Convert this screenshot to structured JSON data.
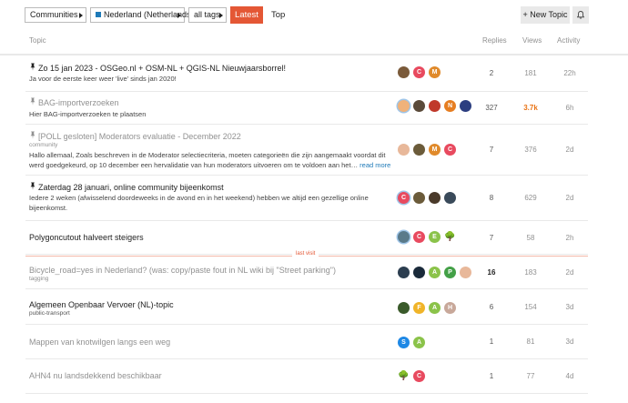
{
  "nav": {
    "categories": "Communities",
    "tag_category": "Nederland (Netherlands)",
    "tags": "all tags",
    "latest": "Latest",
    "top": "Top",
    "new_topic": "+ New Topic",
    "bell_icon": "bell-icon",
    "accent": "#e45735"
  },
  "columns": {
    "topic": "Topic",
    "replies": "Replies",
    "views": "Views",
    "activity": "Activity"
  },
  "last_visit": "last visit",
  "topics": [
    {
      "title": "Zo 15 jan 2023 - OSGeo.nl + OSM-NL + QGIS-NL Nieuwjaarsborrel!",
      "pinned": true,
      "read": false,
      "excerpt": "Ja voor de eerste keer weer 'live' sinds jan 2020!",
      "replies": "2",
      "views": "181",
      "activity": "22h",
      "avatars": [
        {
          "c": "#7a5a3a",
          "t": ""
        },
        {
          "c": "#e84a5f",
          "t": "C"
        },
        {
          "c": "#e08a2b",
          "t": "M"
        }
      ]
    },
    {
      "title": "BAG-importverzoeken",
      "pinned": true,
      "read": true,
      "excerpt": "Hier BAG-importverzoeken te plaatsen",
      "replies": "327",
      "views": "3.7k",
      "activity": "6h",
      "hot": true,
      "avatars": [
        {
          "c": "#f0b27a",
          "t": "",
          "ring": true
        },
        {
          "c": "#5a4a3a",
          "t": ""
        },
        {
          "c": "#c0392b",
          "t": ""
        },
        {
          "c": "#e67e22",
          "t": "N"
        },
        {
          "c": "#2c3e80",
          "t": ""
        }
      ]
    },
    {
      "title": "[POLL gesloten] Moderators evaluatie - December 2022",
      "pinned": true,
      "read": true,
      "category": "community",
      "excerpt_line1": "Hallo allemaal, Zoals beschreven in de Moderator selectiecriteria, moeten categorieën die zijn aangemaakt voordat dit",
      "excerpt_line2": "werd goedgekeurd, op 10 december een hervalidatie van hun moderators uitvoeren om te voldoen aan het…",
      "read_more": "read more",
      "replies": "7",
      "views": "376",
      "activity": "2d",
      "avatars": [
        {
          "c": "#e8b89a",
          "t": ""
        },
        {
          "c": "#6b5b3a",
          "t": ""
        },
        {
          "c": "#e08a2b",
          "t": "M"
        },
        {
          "c": "#e84a5f",
          "t": "C"
        }
      ]
    },
    {
      "title": "Zaterdag 28 januari, online community bijeenkomst",
      "pinned": true,
      "read": false,
      "excerpt_line1": "Iedere 2 weken (afwisselend doordeweeks in de avond en in het weekend) hebben we altijd een gezellige online",
      "excerpt_line2": "bijeenkomst.",
      "replies": "8",
      "views": "629",
      "activity": "2d",
      "avatars": [
        {
          "c": "#e84a5f",
          "t": "C",
          "ring": true
        },
        {
          "c": "#6b5b3a",
          "t": ""
        },
        {
          "c": "#4a3a2a",
          "t": ""
        },
        {
          "c": "#3a4a5a",
          "t": ""
        }
      ]
    },
    {
      "title": "Polygoncutout halveert steigers",
      "pinned": false,
      "read": false,
      "replies": "7",
      "views": "58",
      "activity": "2h",
      "avatars": [
        {
          "c": "#5a7a8a",
          "t": "",
          "ring": true
        },
        {
          "c": "#e84a5f",
          "t": "C"
        },
        {
          "c": "#8bc34a",
          "t": "E"
        },
        {
          "c": "#2e7d32",
          "t": "🌳"
        }
      ]
    },
    {
      "title": "Bicycle_road=yes in Nederland? (was: copy/paste fout in NL wiki bij \"Street parking\")",
      "pinned": false,
      "read": true,
      "category": "tagging",
      "replies": "16",
      "views": "183",
      "activity": "2d",
      "bold_replies": true,
      "avatars": [
        {
          "c": "#2c3e50",
          "t": ""
        },
        {
          "c": "#1a2a3a",
          "t": ""
        },
        {
          "c": "#8bc34a",
          "t": "A"
        },
        {
          "c": "#43a047",
          "t": "P"
        },
        {
          "c": "#e8b89a",
          "t": ""
        }
      ]
    },
    {
      "title": "Algemeen Openbaar Vervoer (NL)-topic",
      "pinned": false,
      "read": false,
      "category": "public-transport",
      "replies": "6",
      "views": "154",
      "activity": "3d",
      "avatars": [
        {
          "c": "#3a5a2a",
          "t": ""
        },
        {
          "c": "#f0b429",
          "t": "F"
        },
        {
          "c": "#8bc34a",
          "t": "A"
        },
        {
          "c": "#c8a89a",
          "t": "H"
        }
      ]
    },
    {
      "title": "Mappen van knotwilgen langs een weg",
      "pinned": false,
      "read": true,
      "replies": "1",
      "views": "81",
      "activity": "3d",
      "avatars": [
        {
          "c": "#1e88e5",
          "t": "S"
        },
        {
          "c": "#8bc34a",
          "t": "A"
        }
      ]
    },
    {
      "title": "AHN4 nu landsdekkend beschikbaar",
      "pinned": false,
      "read": true,
      "replies": "1",
      "views": "77",
      "activity": "4d",
      "avatars": [
        {
          "c": "#2e7d32",
          "t": "🌳"
        },
        {
          "c": "#e84a5f",
          "t": "C"
        }
      ]
    }
  ]
}
